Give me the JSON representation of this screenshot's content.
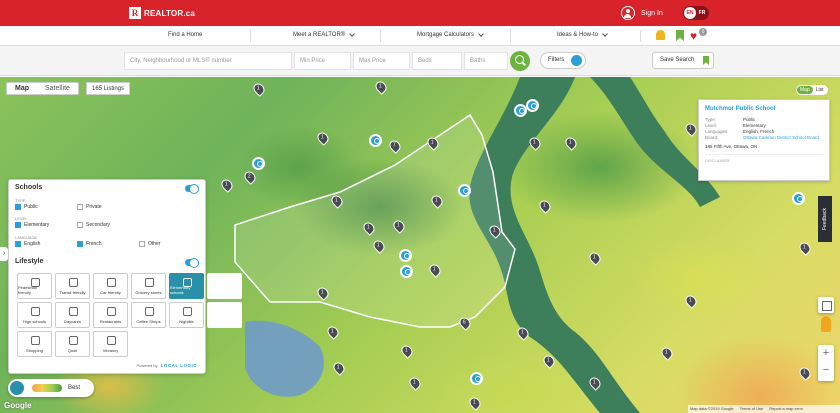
{
  "header": {
    "logo_mark": "R",
    "logo_text": "REALTOR.ca",
    "sign_in": "Sign In",
    "lang_en": "EN",
    "lang_fr": "FR",
    "favourites_count": "0"
  },
  "nav": {
    "items": [
      {
        "label": "Find a Home",
        "has_dropdown": false
      },
      {
        "label": "Meet a REALTOR®",
        "has_dropdown": true
      },
      {
        "label": "Mortgage Calculators",
        "has_dropdown": true
      },
      {
        "label": "Ideas & How-to",
        "has_dropdown": true
      }
    ]
  },
  "search": {
    "location_placeholder": "City, Neighbourhood or MLS® number",
    "min_price": "Min Price",
    "max_price": "Max Price",
    "beds": "Beds",
    "baths": "Baths",
    "filters": "Filters",
    "save_search": "Save Search"
  },
  "map": {
    "tab_map": "Map",
    "tab_satellite": "Satellite",
    "listings_count": "165 Listings",
    "view_map": "Map",
    "view_list": "List",
    "attribution": [
      "Map data ©2019 Google",
      "Terms of Use",
      "Report a map error"
    ],
    "google": "Google"
  },
  "school_card": {
    "title": "Mutchmor Public School",
    "rows": [
      {
        "k": "Type:",
        "v": "Public"
      },
      {
        "k": "Level:",
        "v": "Elementary"
      },
      {
        "k": "Languages:",
        "v": "English, French"
      },
      {
        "k": "Board:",
        "v": "Ottawa-Carleton District School Board"
      }
    ],
    "address": "185 Fifth Ave, Ottawa, ON",
    "disclaimer": "DISCLAIMER"
  },
  "panel": {
    "schools_title": "Schools",
    "type_label": "Type",
    "public": "Public",
    "private": "Private",
    "level_label": "Level",
    "elementary": "Elementary",
    "secondary": "Secondary",
    "language_label": "Language",
    "english": "English",
    "french": "French",
    "other": "Other",
    "lifestyle_title": "Lifestyle",
    "tiles": [
      "Pedestrian friendly",
      "Transit friendly",
      "Car friendly",
      "Grocery stores",
      "Elementary schools",
      "High schools",
      "Daycares",
      "Restaurants",
      "Coffee Shops",
      "Nightlife",
      "Shopping",
      "Quiet",
      "Vibrancy"
    ],
    "powered_by": "Powered by",
    "powered_brand": "LOCAL LOGIC"
  },
  "legend": {
    "best": "Best"
  },
  "feedback": "Feedback",
  "colors": {
    "brand": "#d8232a",
    "accent": "#6cb33f",
    "school": "#2a9fd8"
  }
}
